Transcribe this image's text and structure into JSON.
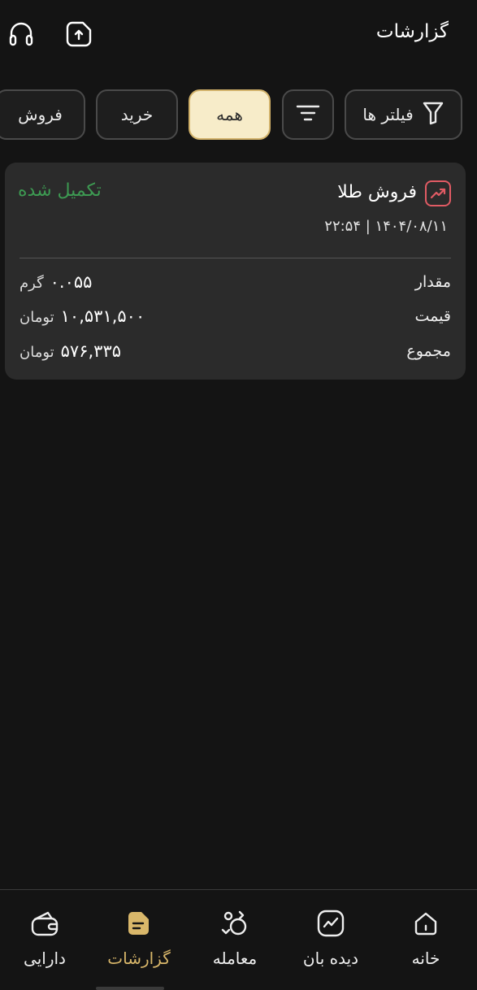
{
  "header": {
    "title": "گزارشات",
    "icons": {
      "support": "headset-icon",
      "export": "upload-icon"
    }
  },
  "filters": {
    "filters_label": "فیلتر ها",
    "all_label": "همه",
    "buy_label": "خرید",
    "sell_label": "فروش",
    "selected": "همه"
  },
  "transactions": [
    {
      "type": "فروش طلا",
      "status": "تکمیل شده",
      "datetime": "۲۲:۵۴ | ۱۴۰۴/۰۸/۱۱",
      "amount_label": "مقدار",
      "amount_value": "۰.۰۵۵",
      "amount_unit": "گرم",
      "price_label": "قیمت",
      "price_value": "۱۰,۵۳۱,۵۰۰",
      "price_unit": "تومان",
      "total_label": "مجموع",
      "total_value": "۵۷۶,۳۳۵",
      "total_unit": "تومان"
    }
  ],
  "bottom_nav": {
    "home": "خانه",
    "watchlist": "دیده بان",
    "trade": "معامله",
    "reports": "گزارشات",
    "assets": "دارایی",
    "active": "گزارشات"
  },
  "colors": {
    "accent": "#d9b76a",
    "success": "#3d9a52",
    "danger": "#e15b64",
    "background": "#141414",
    "card": "#2b2b2b"
  }
}
